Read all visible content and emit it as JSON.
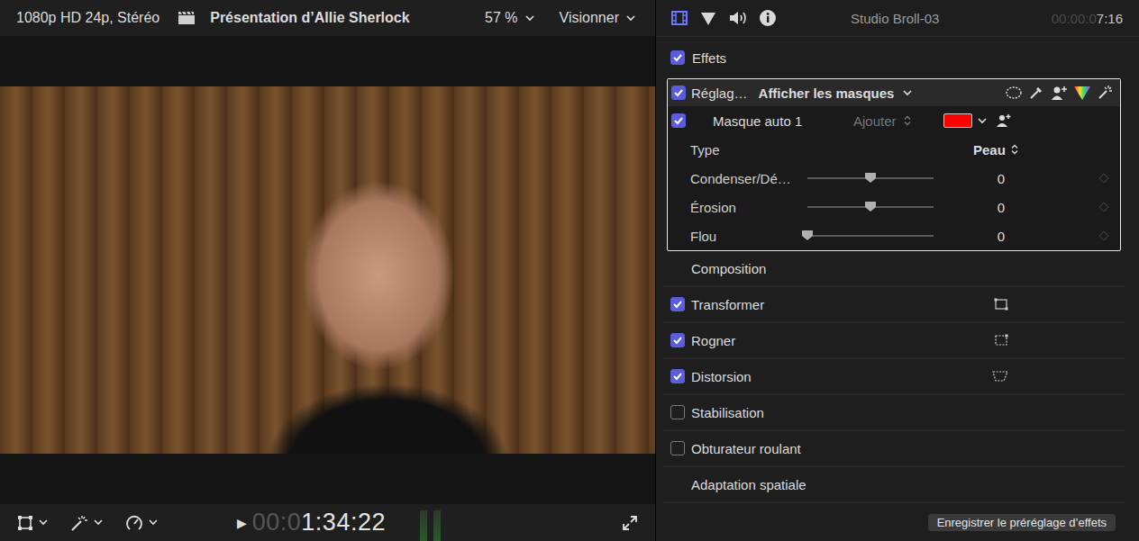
{
  "viewer": {
    "format": "1080p HD 24p, Stéréo",
    "project": "Présentation d’Allie Sherlock",
    "zoom": "57 %",
    "view_menu": "Visionner",
    "play": "▶",
    "timecode": {
      "dim": "00:0",
      "bright": "1:34:22"
    }
  },
  "inspector": {
    "tabs": [
      {
        "selected": true
      },
      {
        "selected": false
      },
      {
        "selected": false
      },
      {
        "selected": false
      }
    ],
    "clip": "Studio Broll-03",
    "timecode": {
      "dim": "00:00:0",
      "bright": "7:16"
    },
    "effects": {
      "label": "Effets",
      "checked": true,
      "effect": {
        "label": "Réglag…",
        "checked": true,
        "mask_menu": "Afficher les masques",
        "mask": {
          "label": "Masque auto 1",
          "checked": true,
          "mode": "Ajouter",
          "color": "#ff0000"
        },
        "params": [
          {
            "kind": "popup",
            "label": "Type",
            "value": "Peau"
          },
          {
            "kind": "slider",
            "label": "Condenser/Dé…",
            "level": 0.5,
            "value": "0"
          },
          {
            "kind": "slider",
            "label": "Érosion",
            "level": 0.5,
            "value": "0"
          },
          {
            "kind": "slider",
            "label": "Flou",
            "level": 0.0,
            "value": "0"
          }
        ]
      }
    },
    "sections": [
      {
        "kind": "header",
        "label": "Composition",
        "checked": false
      },
      {
        "kind": "checkbox",
        "label": "Transformer",
        "checked": true
      },
      {
        "kind": "checkbox",
        "label": "Rogner",
        "checked": true
      },
      {
        "kind": "checkbox",
        "label": "Distorsion",
        "checked": true
      },
      {
        "kind": "checkbox",
        "label": "Stabilisation",
        "checked": false
      },
      {
        "kind": "checkbox",
        "label": "Obturateur roulant",
        "checked": false
      },
      {
        "kind": "header",
        "label": "Adaptation spatiale",
        "checked": false
      }
    ],
    "save_button": "Enregistrer le préréglage d’effets"
  }
}
